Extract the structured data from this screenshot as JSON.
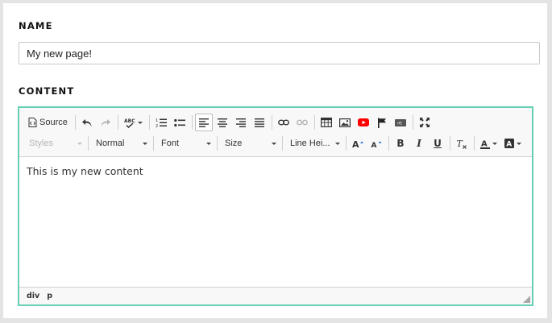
{
  "name_section": {
    "label": "NAME",
    "value": "My new page!"
  },
  "content_section": {
    "label": "CONTENT",
    "editor": {
      "toolbar": {
        "source_label": "Source",
        "styles": "Styles",
        "format": "Normal",
        "font": "Font",
        "size": "Size",
        "line_height": "Line Hei..."
      },
      "body_text": "This is my new content",
      "elements_path": [
        "div",
        "p"
      ]
    }
  },
  "colors": {
    "editor_border": "#67cfb3",
    "youtube_red": "#ff0000"
  }
}
